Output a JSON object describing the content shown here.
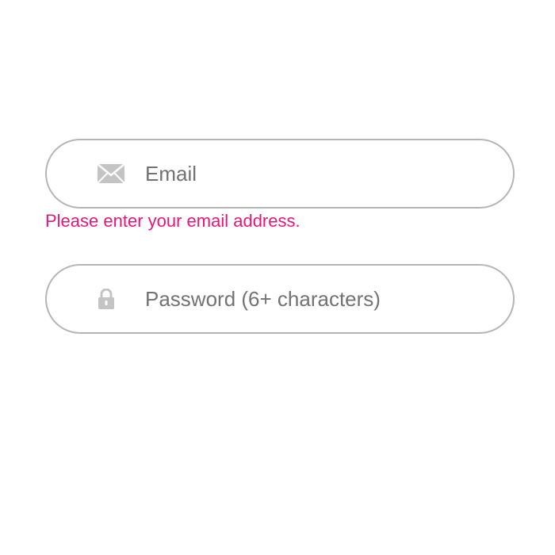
{
  "form": {
    "email": {
      "value": "",
      "placeholder": "Email",
      "icon": "envelope-icon",
      "error": "Please enter your email address."
    },
    "password": {
      "value": "",
      "placeholder": "Password (6+ characters)",
      "icon": "lock-icon"
    }
  },
  "colors": {
    "error": "#e8157a",
    "border": "#b5b5b5",
    "icon": "#bdbdbd",
    "placeholder": "#737373"
  }
}
